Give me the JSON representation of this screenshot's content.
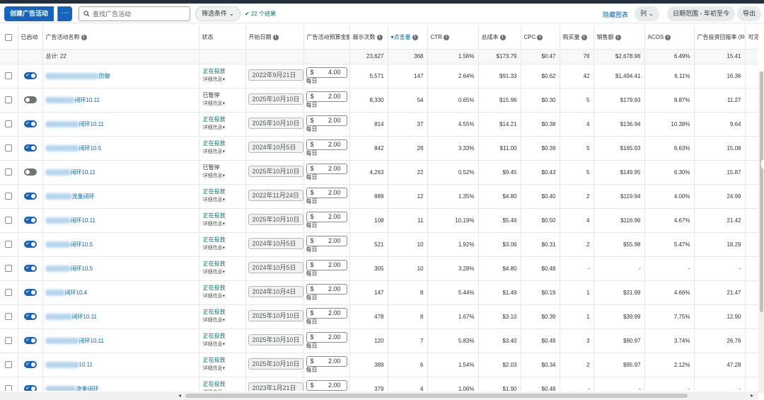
{
  "toolbar": {
    "create_label": "创建广告活动",
    "more_label": "···",
    "search_placeholder": "查找广告活动",
    "filter_label": "筛选条件",
    "results_label": "✔ 22 个结果",
    "hide_chart_label": "隐藏图表",
    "columns_label": "列",
    "date_range_label": "日期范围 - 年初至今",
    "export_label": "导出"
  },
  "columns": {
    "enabled": "已启动",
    "name": "广告活动名称",
    "status": "状态",
    "start_date": "开始日期",
    "budget": "广告活动预算金额",
    "impressions": "展示次数",
    "clicks": "点击量",
    "ctr": "CTR",
    "spend": "总成本",
    "cpc": "CPC",
    "orders": "购买量",
    "sales": "销售额",
    "acos": "ACOS",
    "roas": "广告投资回报率 (ROAS)",
    "extra": "可见"
  },
  "total": {
    "label": "总计: 22",
    "impressions": "23,627",
    "clicks": "368",
    "ctr": "1.56%",
    "spend": "$173.79",
    "cpc": "$0.47",
    "orders": "76",
    "sales": "$2,678.96",
    "acos": "6.49%",
    "roas": "15.41"
  },
  "labels": {
    "detail": "详细信息",
    "per_day": "每日",
    "currency": "$"
  },
  "rows": [
    {
      "on": true,
      "name": "防御",
      "blur_w": 76,
      "status": "正在投放",
      "date": "2022年9月21日",
      "budget": "4.00",
      "impressions": "5,571",
      "clicks": "147",
      "ctr": "2.64%",
      "spend": "$91.33",
      "cpc": "$0.62",
      "orders": "42",
      "sales": "$1,494.41",
      "acos": "6.11%",
      "roas": "16.36"
    },
    {
      "on": false,
      "name": "闭环10.11",
      "blur_w": 42,
      "status": "已暂停",
      "date": "2025年10月10日",
      "budget": "2.00",
      "impressions": "8,330",
      "clicks": "54",
      "ctr": "0.65%",
      "spend": "$15.96",
      "cpc": "$0.30",
      "orders": "5",
      "sales": "$179.93",
      "acos": "8.87%",
      "roas": "11.27"
    },
    {
      "on": true,
      "name": "闭环10.11",
      "blur_w": 48,
      "status": "正在投放",
      "date": "2025年10月10日",
      "budget": "2.00",
      "impressions": "814",
      "clicks": "37",
      "ctr": "4.55%",
      "spend": "$14.21",
      "cpc": "$0.38",
      "orders": "4",
      "sales": "$136.94",
      "acos": "10.38%",
      "roas": "9.64"
    },
    {
      "on": true,
      "name": "闭环10.5",
      "blur_w": 48,
      "status": "正在投放",
      "date": "2024年10月5日",
      "budget": "2.00",
      "impressions": "842",
      "clicks": "28",
      "ctr": "3.33%",
      "spend": "$11.00",
      "cpc": "$0.39",
      "orders": "5",
      "sales": "$165.93",
      "acos": "6.63%",
      "roas": "15.08"
    },
    {
      "on": false,
      "name": "闭环10.11",
      "blur_w": 36,
      "status": "已暂停",
      "date": "2025年10月10日",
      "budget": "2.00",
      "impressions": "4,263",
      "clicks": "22",
      "ctr": "0.52%",
      "spend": "$9.45",
      "cpc": "$0.43",
      "orders": "5",
      "sales": "$149.95",
      "acos": "6.30%",
      "roas": "15.87"
    },
    {
      "on": true,
      "name": "流量闭环",
      "blur_w": 38,
      "status": "正在投放",
      "date": "2022年11月24日",
      "budget": "2.00",
      "impressions": "889",
      "clicks": "12",
      "ctr": "1.35%",
      "spend": "$4.80",
      "cpc": "$0.40",
      "orders": "2",
      "sales": "$119.94",
      "acos": "4.00%",
      "roas": "24.99"
    },
    {
      "on": true,
      "name": "闭环10.11",
      "blur_w": 36,
      "status": "正在投放",
      "date": "2025年10月10日",
      "budget": "2.00",
      "impressions": "108",
      "clicks": "11",
      "ctr": "10.19%",
      "spend": "$5.46",
      "cpc": "$0.50",
      "orders": "4",
      "sales": "$116.96",
      "acos": "4.67%",
      "roas": "21.42"
    },
    {
      "on": true,
      "name": "闭环10.5",
      "blur_w": 36,
      "status": "正在投放",
      "date": "2024年10月5日",
      "budget": "2.00",
      "impressions": "521",
      "clicks": "10",
      "ctr": "1.92%",
      "spend": "$3.06",
      "cpc": "$0.31",
      "orders": "2",
      "sales": "$55.98",
      "acos": "5.47%",
      "roas": "18.29"
    },
    {
      "on": true,
      "name": "闭环10.5",
      "blur_w": 36,
      "status": "正在投放",
      "date": "2024年10月5日",
      "budget": "2.00",
      "impressions": "305",
      "clicks": "10",
      "ctr": "3.28%",
      "spend": "$4.80",
      "cpc": "$0.48",
      "orders": "-",
      "sales": "-",
      "acos": "-",
      "roas": "-"
    },
    {
      "on": true,
      "name": "闭环10.4",
      "blur_w": 28,
      "status": "正在投放",
      "date": "2024年10月4日",
      "budget": "2.00",
      "impressions": "147",
      "clicks": "8",
      "ctr": "5.44%",
      "spend": "$1.49",
      "cpc": "$0.19",
      "orders": "1",
      "sales": "$31.99",
      "acos": "4.66%",
      "roas": "21.47"
    },
    {
      "on": true,
      "name": "闭环10.11",
      "blur_w": 38,
      "status": "正在投放",
      "date": "2025年10月10日",
      "budget": "2.00",
      "impressions": "478",
      "clicks": "8",
      "ctr": "1.67%",
      "spend": "$3.10",
      "cpc": "$0.39",
      "orders": "1",
      "sales": "$39.99",
      "acos": "7.75%",
      "roas": "12.90"
    },
    {
      "on": true,
      "name": "闭环10.11",
      "blur_w": 48,
      "status": "正在投放",
      "date": "2025年10月10日",
      "budget": "2.00",
      "impressions": "120",
      "clicks": "7",
      "ctr": "5.83%",
      "spend": "$3.40",
      "cpc": "$0.49",
      "orders": "3",
      "sales": "$90.97",
      "acos": "3.74%",
      "roas": "26.76"
    },
    {
      "on": true,
      "name": "10.11",
      "blur_w": 48,
      "status": "正在投放",
      "date": "2025年10月10日",
      "budget": "2.00",
      "impressions": "389",
      "clicks": "6",
      "ctr": "1.54%",
      "spend": "$2.03",
      "cpc": "$0.34",
      "orders": "2",
      "sales": "$95.97",
      "acos": "2.12%",
      "roas": "47.28"
    },
    {
      "on": true,
      "name": "流量闭环",
      "blur_w": 44,
      "status": "正在投放",
      "date": "2023年1月21日",
      "budget": "2.00",
      "impressions": "379",
      "clicks": "4",
      "ctr": "1.06%",
      "spend": "$1.90",
      "cpc": "$0.48",
      "orders": "-",
      "sales": "-",
      "acos": "-",
      "roas": "-"
    }
  ]
}
